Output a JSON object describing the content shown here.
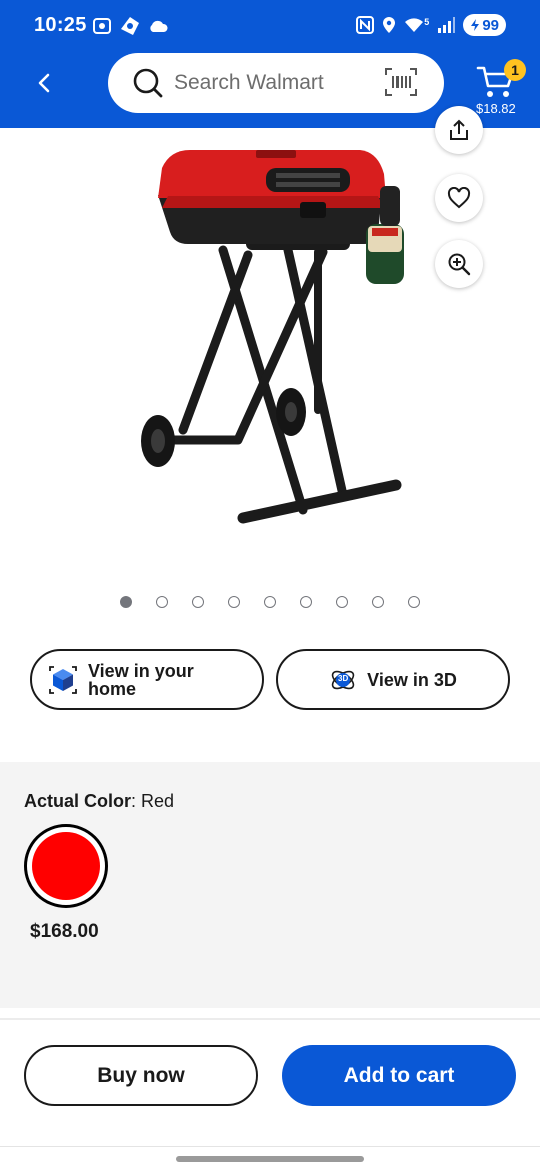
{
  "status_bar": {
    "time": "10:25",
    "network": "5",
    "battery": "99"
  },
  "header": {
    "search_placeholder": "Search Walmart",
    "cart_count": "1",
    "cart_total": "$18.82"
  },
  "product": {
    "image_icon": "portable-grill-image",
    "carousel_total": 9,
    "carousel_active": 1
  },
  "view_buttons": {
    "view_home_label": "View in your home",
    "view_3d_label": "View in 3D",
    "badge_3d": "3D"
  },
  "variant": {
    "label": "Actual Color",
    "value": "Red",
    "swatch_color": "#ff0000",
    "price": "$168.00"
  },
  "actions": {
    "buy_now": "Buy now",
    "add_to_cart": "Add to cart"
  },
  "colors": {
    "brand_blue": "#0a58d6",
    "badge_yellow": "#ffc220"
  }
}
